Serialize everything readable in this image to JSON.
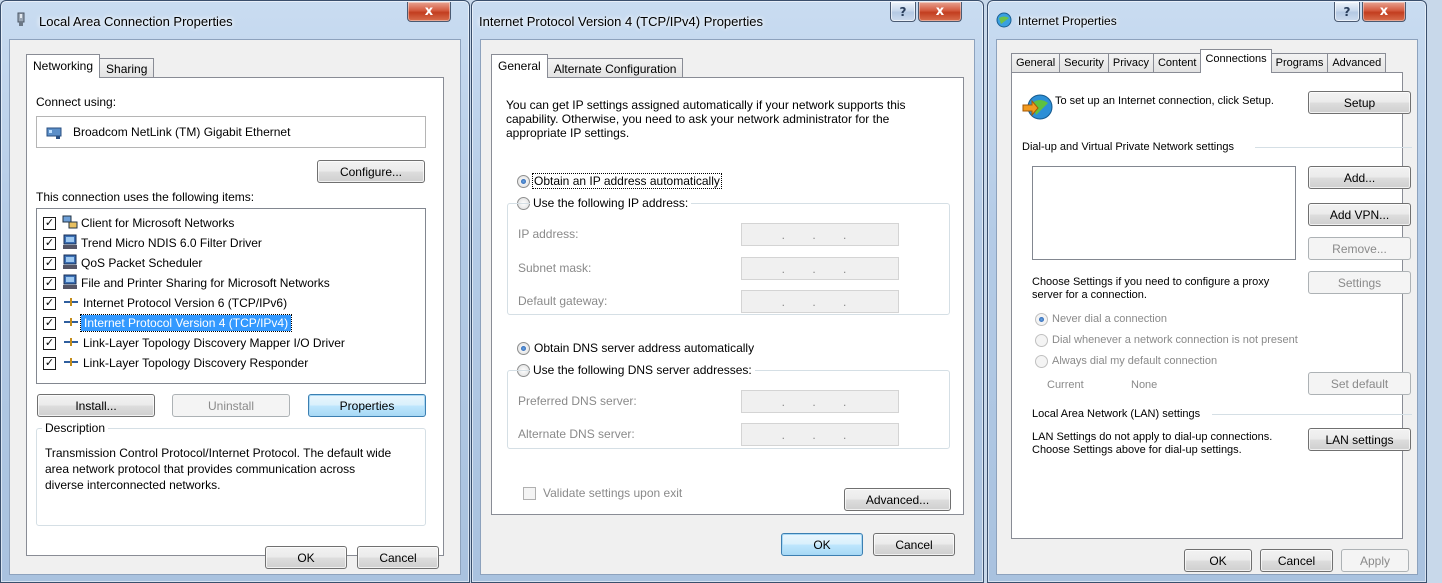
{
  "lan": {
    "title": "Local Area Connection Properties",
    "close": "x",
    "tabs": [
      "Networking",
      "Sharing"
    ],
    "connect_using_label": "Connect using:",
    "adapter": "Broadcom NetLink (TM) Gigabit Ethernet",
    "configure": "Configure...",
    "items_label": "This connection uses the following items:",
    "items": [
      {
        "label": "Client for Microsoft Networks",
        "checked": true,
        "icon": "network-client-icon"
      },
      {
        "label": "Trend Micro NDIS 6.0 Filter Driver",
        "checked": true,
        "icon": "computer-icon"
      },
      {
        "label": "QoS Packet Scheduler",
        "checked": true,
        "icon": "computer-icon"
      },
      {
        "label": "File and Printer Sharing for Microsoft Networks",
        "checked": true,
        "icon": "computer-icon"
      },
      {
        "label": "Internet Protocol Version 6 (TCP/IPv6)",
        "checked": true,
        "icon": "protocol-icon"
      },
      {
        "label": "Internet Protocol Version 4 (TCP/IPv4)",
        "checked": true,
        "icon": "protocol-icon",
        "selected": true
      },
      {
        "label": "Link-Layer Topology Discovery Mapper I/O Driver",
        "checked": true,
        "icon": "protocol-icon"
      },
      {
        "label": "Link-Layer Topology Discovery Responder",
        "checked": true,
        "icon": "protocol-icon"
      }
    ],
    "install": "Install...",
    "uninstall": "Uninstall",
    "properties": "Properties",
    "description_label": "Description",
    "description": "Transmission Control Protocol/Internet Protocol. The default wide area network protocol that provides communication across diverse interconnected networks.",
    "ok": "OK",
    "cancel": "Cancel"
  },
  "ipv4": {
    "title": "Internet Protocol Version 4 (TCP/IPv4) Properties",
    "help": "?",
    "close": "x",
    "tabs": [
      "General",
      "Alternate Configuration"
    ],
    "intro": "You can get IP settings assigned automatically if your network supports this capability. Otherwise, you need to ask your network administrator for the appropriate IP settings.",
    "obtain_ip": "Obtain an IP address automatically",
    "use_ip": "Use the following IP address:",
    "ip_address": "IP address:",
    "subnet_mask": "Subnet mask:",
    "default_gateway": "Default gateway:",
    "ip_dots": ". . .",
    "obtain_dns": "Obtain DNS server address automatically",
    "use_dns": "Use the following DNS server addresses:",
    "preferred_dns": "Preferred DNS server:",
    "alternate_dns": "Alternate DNS server:",
    "validate": "Validate settings upon exit",
    "advanced": "Advanced...",
    "ok": "OK",
    "cancel": "Cancel"
  },
  "inet": {
    "title": "Internet Properties",
    "help": "?",
    "close": "x",
    "tabs": [
      "General",
      "Security",
      "Privacy",
      "Content",
      "Connections",
      "Programs",
      "Advanced"
    ],
    "setup_text": "To set up an Internet connection, click Setup.",
    "setup": "Setup",
    "vpn_label": "Dial-up and Virtual Private Network settings",
    "add": "Add...",
    "add_vpn": "Add VPN...",
    "remove": "Remove...",
    "proxy_text": "Choose Settings if you need to configure a proxy server for a connection.",
    "settings": "Settings",
    "never_dial": "Never dial a connection",
    "dial_whenever": "Dial whenever a network connection is not present",
    "always_dial": "Always dial my default connection",
    "current_label": "Current",
    "current_value": "None",
    "set_default": "Set default",
    "lan_label": "Local Area Network (LAN) settings",
    "lan_text": "LAN Settings do not apply to dial-up connections. Choose Settings above for dial-up settings.",
    "lan_settings": "LAN settings",
    "ok": "OK",
    "cancel": "Cancel",
    "apply": "Apply"
  }
}
